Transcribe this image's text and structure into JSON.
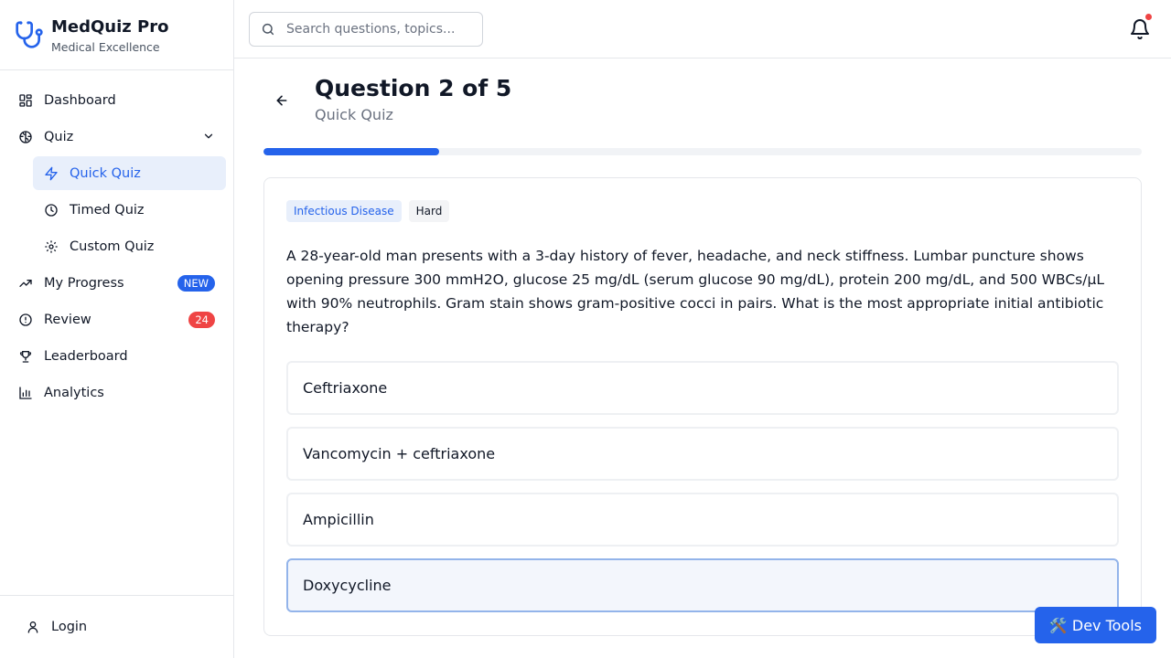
{
  "brand": {
    "title": "MedQuiz Pro",
    "subtitle": "Medical Excellence",
    "accent": "#2563eb"
  },
  "sidebar": {
    "items": [
      {
        "label": "Dashboard",
        "icon": "dashboard-icon"
      },
      {
        "label": "Quiz",
        "icon": "brain-icon",
        "expanded": true
      },
      {
        "label": "Quick Quiz",
        "icon": "zap-icon",
        "active": true
      },
      {
        "label": "Timed Quiz",
        "icon": "clock-icon"
      },
      {
        "label": "Custom Quiz",
        "icon": "gear-icon"
      },
      {
        "label": "My Progress",
        "icon": "trending-up-icon",
        "badge": "NEW"
      },
      {
        "label": "Review",
        "icon": "alert-circle-icon",
        "badge": "24"
      },
      {
        "label": "Leaderboard",
        "icon": "trophy-icon"
      },
      {
        "label": "Analytics",
        "icon": "bar-chart-icon"
      }
    ],
    "footer": {
      "label": "Login",
      "icon": "user-icon"
    }
  },
  "topbar": {
    "search_placeholder": "Search questions, topics...",
    "notification_dot_color": "#ef4444"
  },
  "quiz": {
    "title": "Question 2 of 5",
    "subtitle": "Quick Quiz",
    "progress_fraction": 0.2,
    "tags": {
      "category": "Infectious Disease",
      "difficulty": "Hard"
    },
    "question": "A 28-year-old man presents with a 3-day history of fever, headache, and neck stiffness. Lumbar puncture shows opening pressure 300 mmH2O, glucose 25 mg/dL (serum glucose 90 mg/dL), protein 200 mg/dL, and 500 WBCs/µL with 90% neutrophils. Gram stain shows gram-positive cocci in pairs. What is the most appropriate initial antibiotic therapy?",
    "options": [
      {
        "label": "Ceftriaxone",
        "selected": false
      },
      {
        "label": "Vancomycin + ceftriaxone",
        "selected": false
      },
      {
        "label": "Ampicillin",
        "selected": false
      },
      {
        "label": "Doxycycline",
        "selected": true
      }
    ]
  },
  "devtools": {
    "label": "🛠️ Dev Tools"
  }
}
